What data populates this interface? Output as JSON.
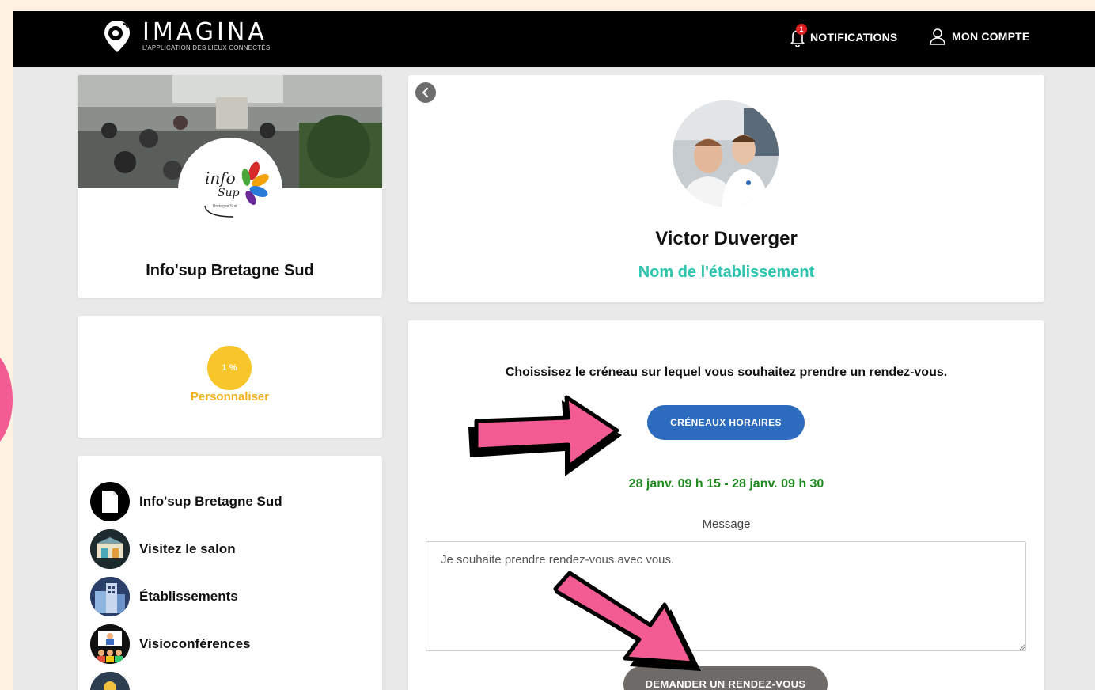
{
  "header": {
    "brand_name": "IMAGINA",
    "brand_tagline": "L'APPLICATION DES LIEUX CONNECTÉS",
    "notifications_label": "NOTIFICATIONS",
    "notifications_count": "1",
    "account_label": "MON COMPTE"
  },
  "organization": {
    "name": "Info'sup Bretagne Sud",
    "logo_text_main": "info",
    "logo_text_sup": "Sup",
    "logo_text_region": "Bretagne Sud"
  },
  "progress": {
    "percent_label": "1 %",
    "action_label": "Personnaliser"
  },
  "menu": {
    "items": [
      {
        "label": "Info'sup Bretagne Sud",
        "icon": "document-icon"
      },
      {
        "label": "Visitez le salon",
        "icon": "salon-icon"
      },
      {
        "label": "Établissements",
        "icon": "buildings-icon"
      },
      {
        "label": "Visioconférences",
        "icon": "video-conference-icon"
      }
    ]
  },
  "person": {
    "name": "Victor Duverger",
    "establishment": "Nom de l'établissement"
  },
  "booking": {
    "instruction": "Choissisez le créneau sur lequel vous souhaitez prendre un rendez-vous.",
    "slots_button": "CRÉNEAUX HORAIRES",
    "selected_slot": "28 janv. 09 h 15 - 28 janv. 09 h 30",
    "message_label": "Message",
    "message_value": "Je souhaite prendre rendez-vous avec vous.",
    "request_button": "DEMANDER UN RENDEZ-VOUS"
  },
  "colors": {
    "header_bg": "#000000",
    "accent_teal": "#2ec4b0",
    "primary_blue": "#2c6bbd",
    "slot_green": "#1f8a1f",
    "progress_yellow": "#f8c62a",
    "annotation_pink": "#f25c93",
    "request_button_grey": "#6e6a67"
  }
}
